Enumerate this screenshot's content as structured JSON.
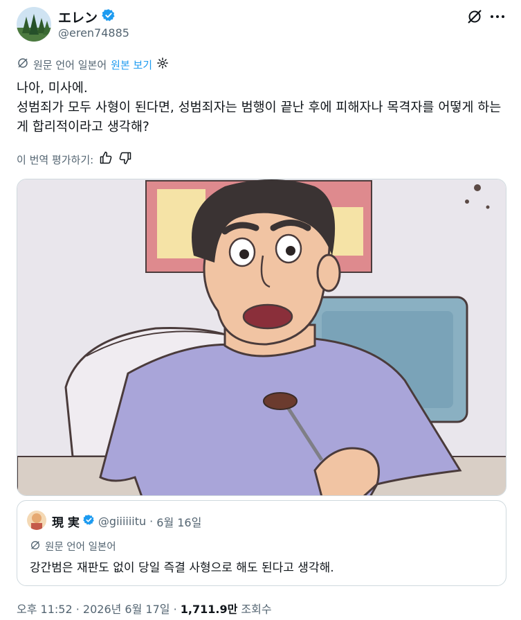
{
  "author": {
    "display_name": "エレン",
    "handle": "@eren74885",
    "verified": true
  },
  "icons": {
    "verified": "verified-badge-icon",
    "grok": "grok-icon",
    "more": "more-icon",
    "translate": "translate-icon",
    "settings": "gear-icon",
    "thumbs_up": "thumbs-up-icon",
    "thumbs_down": "thumbs-down-icon"
  },
  "translation": {
    "note": "원문 언어 일본어",
    "show_original": "원본 보기",
    "rate_label": "이 번역 평가하기:"
  },
  "tweet": {
    "line1": "나아, 미사에.",
    "line2": "성범죄가 모두 사형이 된다면, 성범죄자는 범행이 끝난 후에 피해자나 목격자를 어떻게 하는 게 합리적이라고 생각해?"
  },
  "quote": {
    "display_name": "現 実",
    "handle": "@giiiiiitu",
    "date": "6월 16일",
    "translation_note": "원문 언어 일본어",
    "text": "강간범은 재판도 없이 당일 즉결 사형으로 해도 된다고 생각해."
  },
  "footer": {
    "time": "오후 11:52",
    "date": "2026년 6월 17일",
    "views_count": "1,711.9만",
    "views_label": "조회수"
  },
  "colors": {
    "accent": "#1d9bf0",
    "secondary_text": "#536471",
    "border": "#cfd9de"
  }
}
